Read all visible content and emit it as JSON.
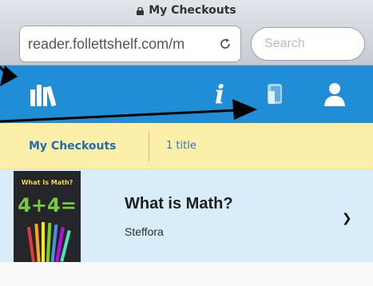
{
  "browser": {
    "page_title": "My Checkouts",
    "url": "reader.follettshelf.com/m",
    "search_placeholder": "Search"
  },
  "toolbar": {
    "icons": [
      "bookshelf-icon",
      "info-icon",
      "checkouts-icon",
      "user-icon"
    ],
    "info_glyph": "i",
    "color": "#1f8ed6"
  },
  "checkouts": {
    "tab_label": "My Checkouts",
    "count_label": "1 title"
  },
  "items": [
    {
      "title": "What is Math?",
      "author": "Steffora",
      "cover_title": "What Is Math?",
      "cover_equation": "4+4="
    }
  ],
  "colors": {
    "toolbar": "#1f8ed6",
    "header_bg": "#fcefa9",
    "row_bg": "#d8edf9",
    "link": "#1a6fb3"
  }
}
